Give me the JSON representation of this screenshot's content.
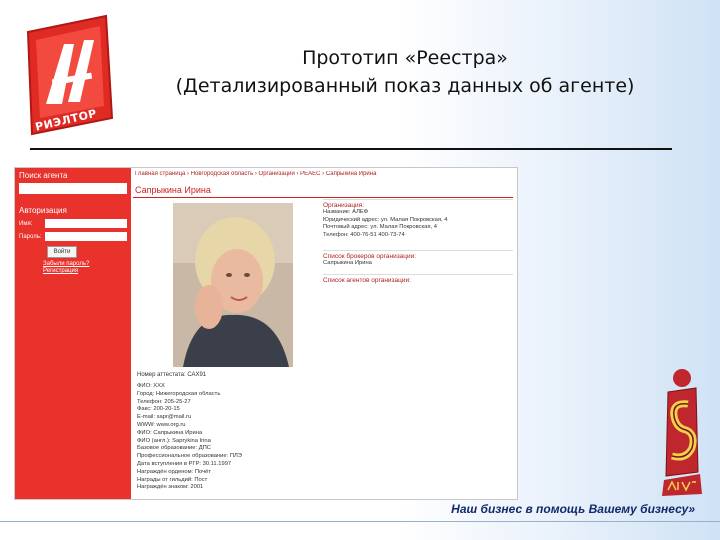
{
  "slide": {
    "title_line1": "Прототип «Реестра»",
    "title_line2": "(Детализированный показ данных об агенте)",
    "slogan": "Наш бизнес в помощь Вашему бизнесу»",
    "logo_text": "РИЭЛТОР"
  },
  "site": {
    "sidebar": {
      "search_header": "Поиск агента",
      "auth_header": "Авторизация",
      "login_label": "Имя:",
      "password_label": "Пароль:",
      "login_button": "Войти",
      "forgot_link": "Забыли пароль?",
      "register_link": "Регистрация"
    },
    "breadcrumb": "Главная страница › Новгородская область › Организации › РЕАЕС › Сапрыкина Ирина",
    "agent_name": "Сапрыкина Ирина",
    "reg_number": "Номер аттестата: САХ91",
    "details": [
      "ФИО: ХХХ",
      "Город: Нижегородская область",
      "Телефон: 205-25-27",
      "Факс: 200-20-15",
      "E-mail: sapr@mail.ru",
      "WWW: www.org.ru",
      "ФИО: Сапрыкина Ирина",
      "ФИО (англ.): Saprykina Irina",
      "Базовое образование: ДПС",
      "Профессиональное образование: ПЛЭ",
      "Дата вступления в РГР: 30.11.1997",
      "Награждён орденом: Почёт",
      "Награды от гильдий: Пост",
      "Награждён знаком: 2001"
    ],
    "org_box": {
      "header": "Организация:",
      "lines": [
        "Название: АЛЕФ",
        "Юридический адрес: ул. Малая Покровская, 4",
        "Почтовый адрес: ул. Малая Покровская, 4",
        "Телефон: 400-76-51 400-73-74"
      ]
    },
    "brokers_box": {
      "header": "Список брокеров организации:",
      "lines": [
        "Сапрыкина Ирина"
      ]
    },
    "agents_box": {
      "header": "Список агентов организации:",
      "lines": []
    }
  },
  "colors": {
    "sidebar": "#e8322b",
    "slogan": "#112a6b"
  }
}
